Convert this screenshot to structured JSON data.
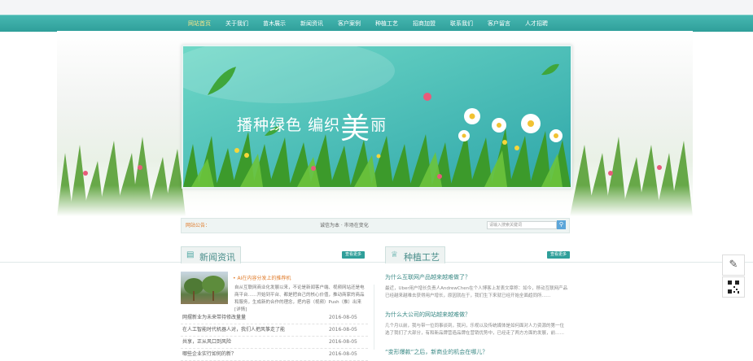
{
  "nav": {
    "items": [
      "网站首页",
      "关于我们",
      "苗木展示",
      "新闻资讯",
      "客户案例",
      "种植工艺",
      "招商加盟",
      "联系我们",
      "客户留言",
      "人才招聘"
    ],
    "active_index": 0
  },
  "banner": {
    "title_part1": "播种绿色",
    "title_part2": "编织",
    "title_big": "美",
    "title_part3": "丽"
  },
  "notice": {
    "label": "网站公告：",
    "text": "诚信为本 · 市场在变化",
    "search_placeholder": "请输入搜索关键词",
    "search_icon": "search-icon"
  },
  "news": {
    "title": "新闻资讯",
    "more": "查看更多",
    "featured_title": "• AI在内容分发上的推荐机",
    "featured_desc": "自从互联网商业化发展以来，不论是新闻客户端、视频网站还是电商平台……开始到平台、都是把自己的核心价值，推动商家的商品和服务，生成新的合作的理念，把内容（视频）Push（推）出来[详情]",
    "items": [
      {
        "title": "网摆新业为未来带持修改量量",
        "date": "2016-08-05"
      },
      {
        "title": "在人工智能时代机器人对，我们人把风筝走了能",
        "date": "2016-08-05"
      },
      {
        "title": "共享，正从风口到风险",
        "date": "2016-08-05"
      },
      {
        "title": "哪些企业实行如何的新？",
        "date": "2016-08-05"
      }
    ]
  },
  "craft": {
    "title": "种植工艺",
    "more": "查看更多",
    "items": [
      {
        "q": "为什么互联网产品越来越难做了？",
        "a": "最近，Uber用户增长负责人AndrewChen在个人博客上发表文章称：如今，移动互联网产品已经越来越难去获得用户增长，原因就在于，我们生下来就已经开始全面趋同所……"
      },
      {
        "q": "为什么大公司的网站越来越难做？",
        "a": "几个月以前，我与带一位同事谈到，我问，乐视以及传统媒体是如何面对人力资源的第一位选了我们了大部分，有和新品牌营造品牌在营销优势中，已经走了两方方面的发展，前……"
      },
      {
        "q": "“变形爆款”之后，新商业的机会在哪儿？",
        "a": ""
      }
    ]
  },
  "side_tools": {
    "edit_icon": "edit-icon",
    "qr_icon": "qr-code-icon"
  }
}
